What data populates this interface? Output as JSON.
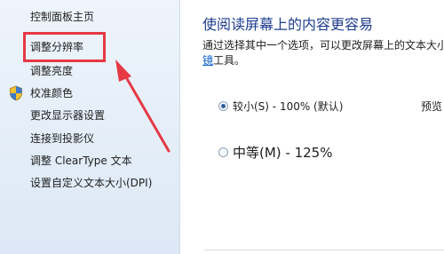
{
  "sidebar": {
    "items": [
      {
        "label": "控制面板主页"
      },
      {
        "label": "调整分辨率"
      },
      {
        "label": "调整亮度"
      },
      {
        "label": "校准颜色",
        "icon": "shield-icon"
      },
      {
        "label": "更改显示器设置"
      },
      {
        "label": "连接到投影仪"
      },
      {
        "label": "调整 ClearType 文本"
      },
      {
        "label": "设置自定义文本大小(DPI)"
      }
    ]
  },
  "main": {
    "title": "使阅读屏幕上的内容更容易",
    "description_line1": "通过选择其中一个选项，可以更改屏幕上的文本大小",
    "description_link": "镜",
    "description_line2_rest": "工具。",
    "options": [
      {
        "label": "较小(S) - 100% (默认)",
        "selected": true
      },
      {
        "label": "中等(M) - 125%",
        "selected": false
      }
    ],
    "preview_label": "预览"
  },
  "colors": {
    "annotation": "#e53945",
    "title": "#1e3d8f",
    "link": "#0b5fd0"
  }
}
